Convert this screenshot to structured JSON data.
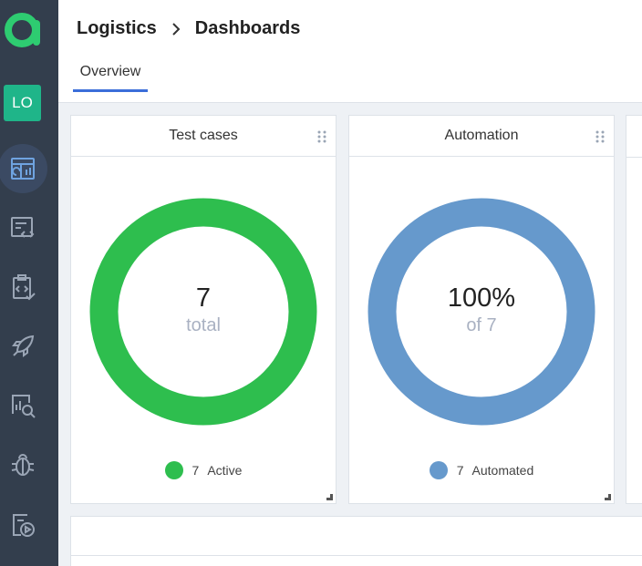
{
  "sidebar": {
    "logo_icon": "app-logo-icon",
    "project_badge": "LO",
    "nav": [
      {
        "icon": "dashboard-icon",
        "active": true
      },
      {
        "icon": "test-cases-icon",
        "active": false
      },
      {
        "icon": "test-plans-icon",
        "active": false
      },
      {
        "icon": "launches-rocket-icon",
        "active": false
      },
      {
        "icon": "analytics-search-icon",
        "active": false
      },
      {
        "icon": "defects-bug-icon",
        "active": false
      },
      {
        "icon": "test-results-icon",
        "active": false
      }
    ]
  },
  "header": {
    "breadcrumb": [
      "Logistics",
      "Dashboards"
    ],
    "tab": "Overview"
  },
  "widgets": [
    {
      "title": "Test cases",
      "center_value": "7",
      "center_sub": "total",
      "legend_count": "7",
      "legend_label": "Active",
      "color": "#2ebe4e",
      "ratio": 1.0
    },
    {
      "title": "Automation",
      "center_value": "100%",
      "center_sub": "of 7",
      "legend_count": "7",
      "legend_label": "Automated",
      "color": "#6699cc",
      "ratio": 1.0
    }
  ],
  "colors": {
    "sidebar_bg": "#333e4d",
    "accent": "#3b6ed9",
    "badge": "#1fb589"
  }
}
